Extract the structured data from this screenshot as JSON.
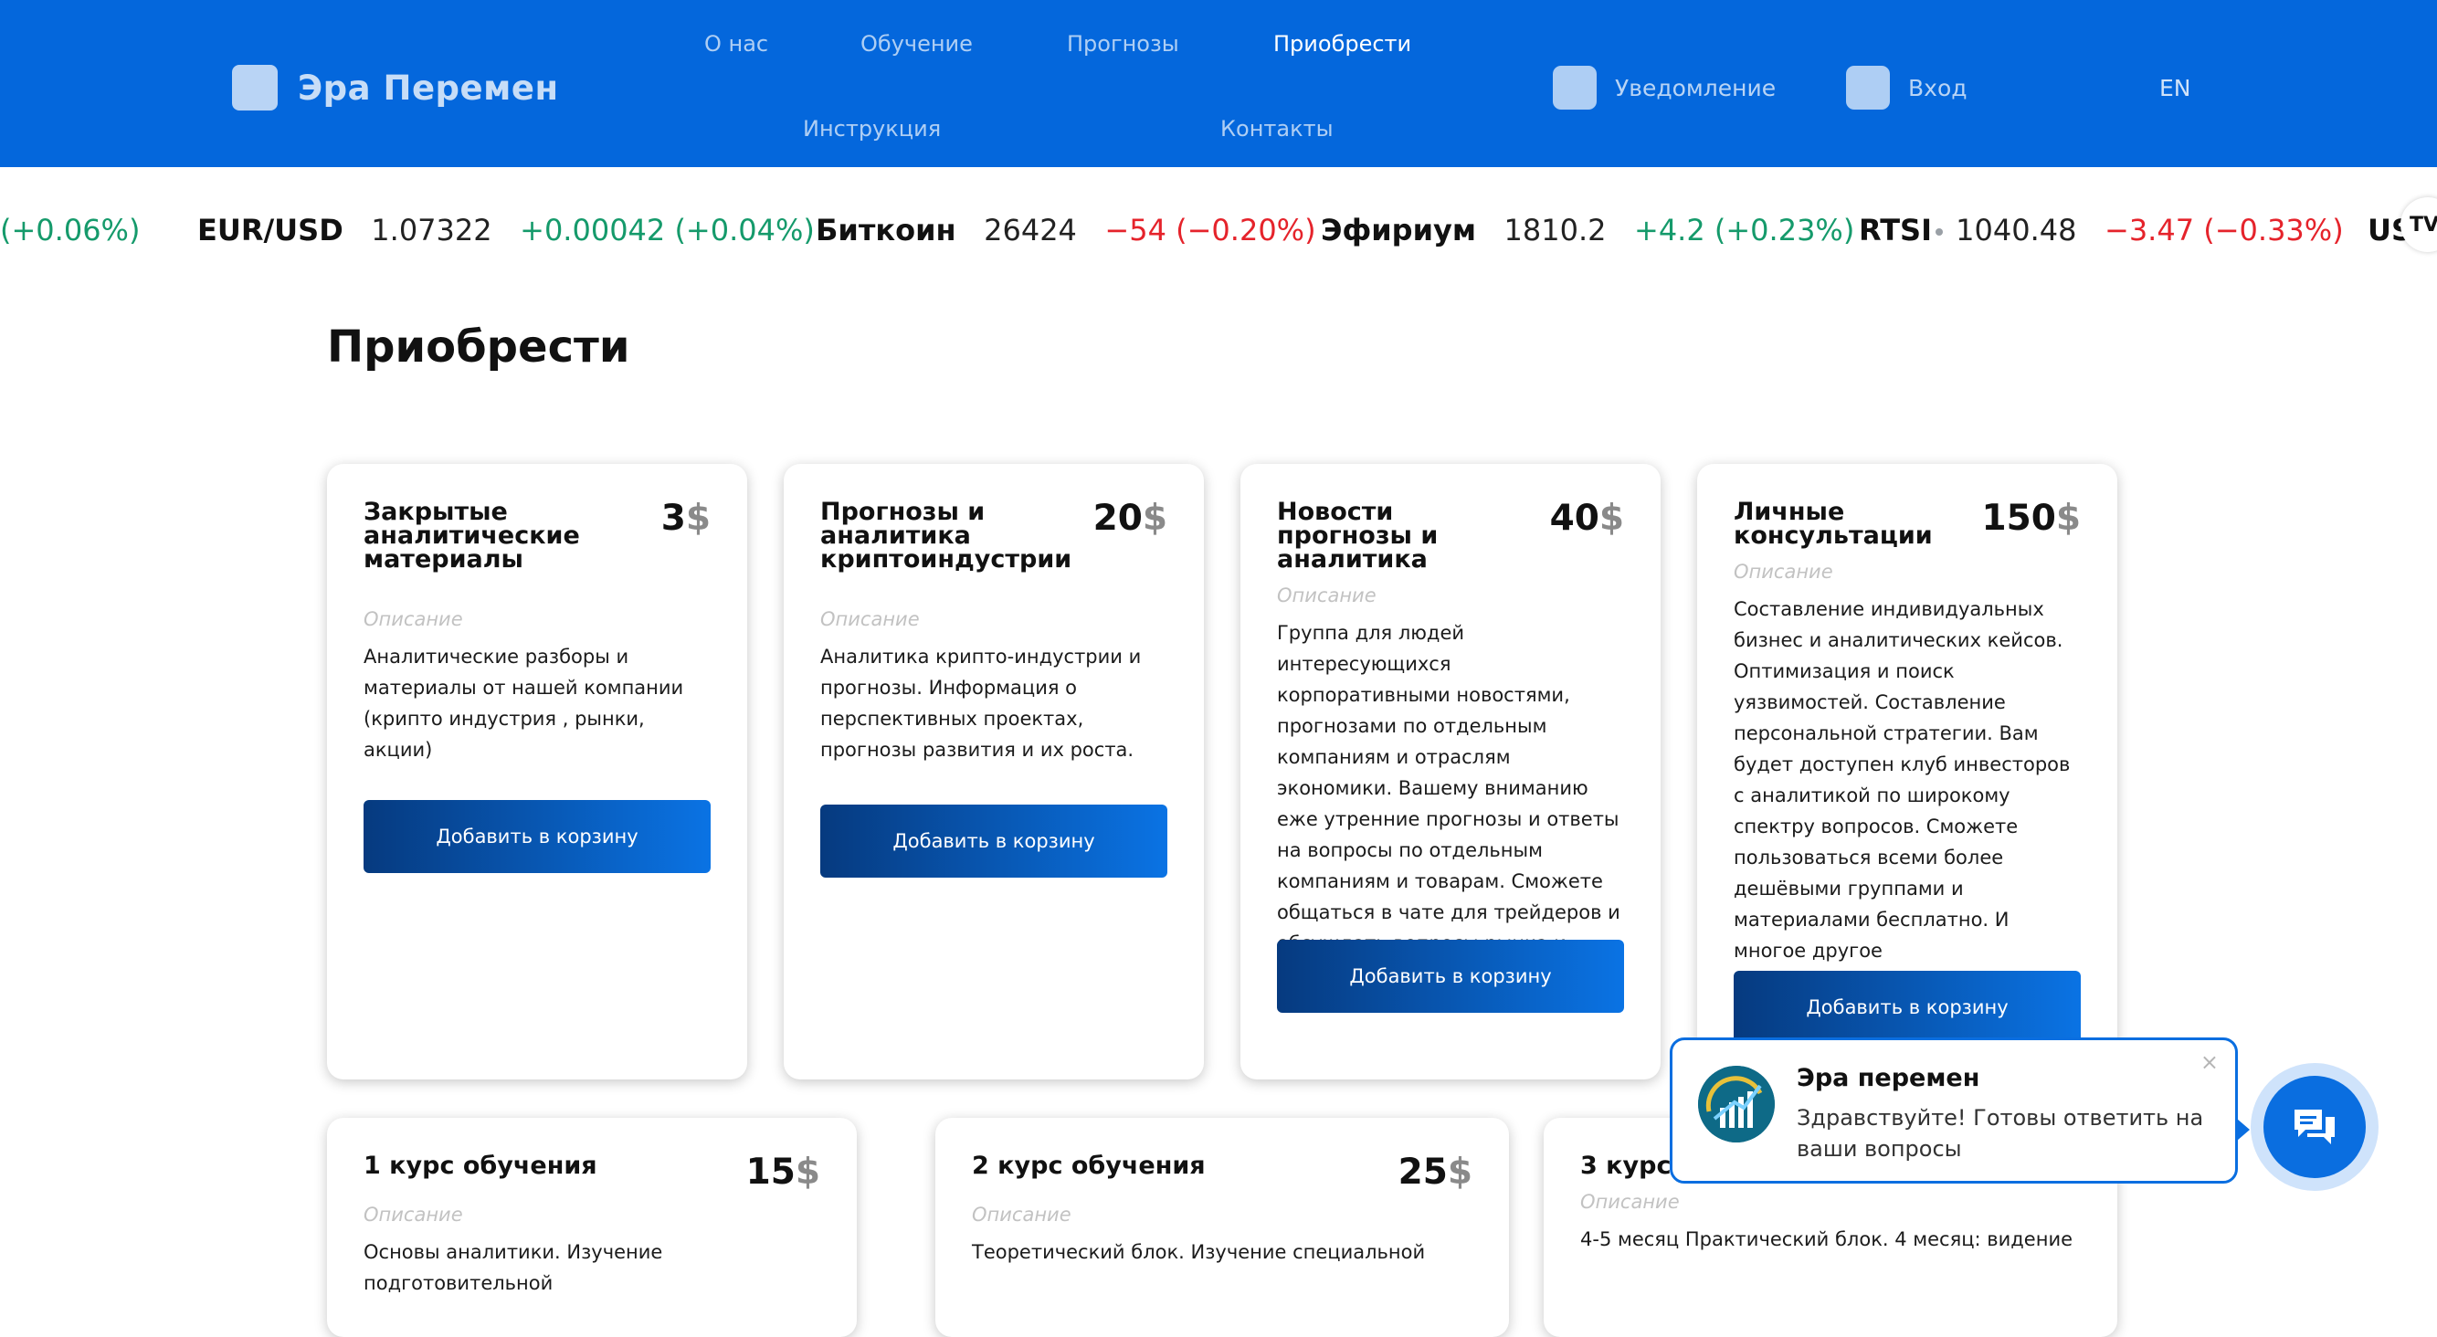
{
  "header": {
    "logo_text": "Эра Перемен",
    "nav": [
      "О нас",
      "Обучение",
      "Прогнозы",
      "Приобрести",
      "Инструкция",
      "Контакты"
    ],
    "active_nav": "Приобрести",
    "notifications_label": "Уведомление",
    "login_label": "Вход",
    "lang_label": "EN"
  },
  "ticker": [
    {
      "symbol": "",
      "value": "",
      "change": "(+0.06%)",
      "direction": "up"
    },
    {
      "symbol": "EUR/USD",
      "value": "1.07322",
      "change": "+0.00042 (+0.04%)",
      "direction": "up"
    },
    {
      "symbol": "Биткоин",
      "value": "26424",
      "change": "−54 (−0.20%)",
      "direction": "down"
    },
    {
      "symbol": "Эфириум",
      "value": "1810.2",
      "change": "+4.2 (+0.23%)",
      "direction": "up"
    },
    {
      "symbol": "RTSI",
      "value": "1040.48",
      "change": "−3.47 (−0.33%)",
      "direction": "down"
    },
    {
      "symbol": "US",
      "value": "",
      "change": "",
      "direction": ""
    }
  ],
  "ticker_logo_text": "TV",
  "page_title": "Приобрести",
  "cards": [
    {
      "title": "Закрытые аналитические материалы",
      "price": "3",
      "currency": "$",
      "desc_label": "Описание",
      "text": "Аналитические разборы и материалы от нашей компании (крипто индустрия , рынки, акции)",
      "button": "Добавить в корзину"
    },
    {
      "title": "Прогнозы и аналитика криптоиндустрии",
      "price": "20",
      "currency": "$",
      "desc_label": "Описание",
      "text": "Аналитика крипто-индустрии и прогнозы. Информация о перспективных проектах, прогнозы развития и их роста.",
      "button": "Добавить в корзину"
    },
    {
      "title": "Новости прогнозы и аналитика",
      "price": "40",
      "currency": "$",
      "desc_label": "Описание",
      "text": "Группа для людей интересующихся корпоративными новостями, прогнозами по отдельным компаниям и отраслям экономики. Вашему вниманию еже утренние прогнозы и ответы на вопросы по отдельным компаниям и товарам. Сможете общаться в чате для трейдеров и обсуждать вопросы рынка и экономики.",
      "button": "Добавить в корзину"
    },
    {
      "title": "Личные консультации",
      "price": "150",
      "currency": "$",
      "desc_label": "Описание",
      "text": "Составление индивидуальных бизнес и аналитических кейсов. Оптимизация и поиск уязвимостей. Составление персональной стратегии. Вам будет доступен клуб инвесторов с аналитикой по широкому спектру вопросов. Сможете пользоваться всеми более дешёвыми группами и материалами бесплатно. И многое другое",
      "button": "Добавить в корзину"
    },
    {
      "title": "1 курс обучения",
      "price": "15",
      "currency": "$",
      "desc_label": "Описание",
      "text": "Основы аналитики. Изучение подготовительной"
    },
    {
      "title": "2 курс обучения",
      "price": "25",
      "currency": "$",
      "desc_label": "Описание",
      "text": "Теоретический блок. Изучение специальной"
    },
    {
      "title": "3 курс",
      "price": "",
      "currency": "",
      "desc_label": "Описание",
      "text": "4-5 месяц Практический блок. 4 месяц: видение"
    }
  ],
  "chat": {
    "name": "Эра перемен",
    "message": "Здравствуйте! Готовы ответить на ваши вопросы",
    "close": "×"
  },
  "colors": {
    "header_bg": "#0467dc",
    "up": "#159a6b",
    "down": "#e5232b",
    "button_from": "#063a7f",
    "button_to": "#0a73e4"
  }
}
